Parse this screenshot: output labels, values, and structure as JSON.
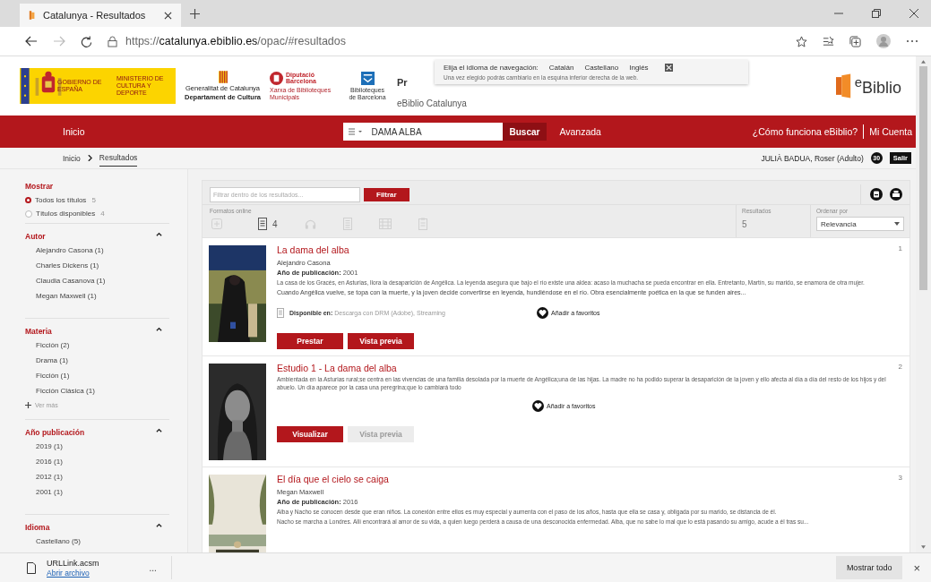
{
  "browser": {
    "tab_title": "Catalunya - Resultados",
    "url": {
      "scheme": "https://",
      "host": "catalunya.ebiblio.es",
      "path": "/opac/#resultados"
    }
  },
  "header": {
    "spain_gov": "GOBIERNO DE ESPAÑA",
    "ministry": "MINISTERIO DE CULTURA Y DEPORTE",
    "generalitat": "Generalitat de Catalunya",
    "department": "Departament de Cultura",
    "diputacio": "Diputació Barcelona",
    "xarxa": "Xarxa de Biblioteques Municipals",
    "bcn": "Biblioteques de Barcelona",
    "platform_start": "Pr",
    "platform": "eBiblio Catalunya",
    "logo": "$^{e}$Biblio"
  },
  "language_popup": {
    "prompt": "Elija el idioma de navegación:",
    "languages": [
      "Catalán",
      "Castellano",
      "Inglés"
    ],
    "note": "Una vez elegido podrás cambiarlo en la esquina inferior derecha de la web."
  },
  "nav": {
    "home": "Inicio",
    "search_value": "DAMA ALBA",
    "search_button": "Buscar",
    "advanced": "Avanzada",
    "help": "¿Cómo funciona eBiblio?",
    "account": "Mi Cuenta"
  },
  "breadcrumb": [
    {
      "label": "Inicio",
      "selected": false
    },
    {
      "label": "Resultados",
      "selected": true
    }
  ],
  "user": {
    "name": "JULIÀ BADUA, Roser (Adulto)",
    "badge": "30",
    "logout": "Salir"
  },
  "sidebar": {
    "show_title": "Mostrar",
    "show_options": [
      {
        "label": "Todos los títulos",
        "count": "5",
        "selected": true
      },
      {
        "label": "Títulos disponibles",
        "count": "4",
        "selected": false
      }
    ],
    "facets": [
      {
        "title": "Autor",
        "expanded": true,
        "items": [
          "Alejandro Casona (1)",
          "Charles Dickens (1)",
          "Claudia Casanova (1)",
          "Megan Maxwell (1)"
        ]
      },
      {
        "title": "Materia",
        "expanded": true,
        "items": [
          "Ficción (2)",
          "Drama (1)",
          "Ficción (1)",
          "Ficción Clásica (1)"
        ],
        "more": "Ver más"
      },
      {
        "title": "Año publicación",
        "expanded": true,
        "items": [
          "2019 (1)",
          "2016 (1)",
          "2012 (1)",
          "2001 (1)"
        ]
      },
      {
        "title": "Idioma",
        "expanded": true,
        "items": [
          "Castellano (5)"
        ]
      }
    ]
  },
  "toolbar": {
    "filter_placeholder": "Filtrar dentro de los resultados...",
    "filter_button": "Filtrar",
    "formats_label": "Formatos online",
    "formats": [
      {
        "kind": "add",
        "enabled": false
      },
      {
        "kind": "ebook",
        "enabled": true,
        "count": "4"
      },
      {
        "kind": "audio",
        "enabled": false
      },
      {
        "kind": "document",
        "enabled": false
      },
      {
        "kind": "video",
        "enabled": false
      },
      {
        "kind": "magazine",
        "enabled": false
      }
    ],
    "results_label": "Resultados",
    "results_count": "5",
    "sort_label": "Ordenar por",
    "sort_value": "Relevancia"
  },
  "results": [
    {
      "number": "1",
      "title": "La dama del alba",
      "author": "Alejandro Casona",
      "year_label": "Año de publicación:",
      "year": "2001",
      "description": [
        "La casa de los Gracés, en Asturias, llora la desaparición de Angélica. La leyenda asegura que bajo el río existe una aldea: acaso la muchacha se pueda encontrar en ella. Entretanto, Martín, su marido, se enamora de otra mujer.",
        "Cuando Angélica vuelve, se topa con la muerte, y la joven decide convertirse en leyenda, hundiéndose en el río. Obra esencialmente poética en la que se funden aires..."
      ],
      "availability_label": "Disponible en:",
      "availability": "Descarga con DRM (Adobe), Streaming",
      "favorite": "Añadir a favoritos",
      "buttons": [
        {
          "label": "Prestar",
          "disabled": false
        },
        {
          "label": "Vista previa",
          "disabled": false
        }
      ]
    },
    {
      "number": "2",
      "title": "Estudio 1 - La dama del alba",
      "description": [
        "Ambientada en la Asturias rural;se centra en las vivencias de una familia desolada por la muerte de Angélica;una de las hijas. La madre no ha podido superar la desaparición de la joven y ello afecta al día a día del resto de los hijos y del abuelo. Un día aparece por la casa una peregrina;que lo cambiará todo"
      ],
      "favorite": "Añadir a favoritos",
      "buttons": [
        {
          "label": "Visualizar",
          "disabled": false
        },
        {
          "label": "Vista previa",
          "disabled": true
        }
      ]
    },
    {
      "number": "3",
      "title": "El día que el cielo se caiga",
      "author": "Megan Maxwell",
      "year_label": "Año de publicación:",
      "year": "2016",
      "description": [
        "Alba y Nacho se conocen desde que eran niños. La conexión entre ellos es muy especial y aumenta con el paso de los años, hasta que ella se casa y, obligada por su marido, se distancia de él.",
        "Nacho se marcha a Londres. Allí encontrará al amor de su vida, a quien luego perderá a causa de una desconocida enfermedad. Alba, que no sabe lo mal que lo está pasando su amigo, acude a él tras su..."
      ]
    }
  ],
  "download_bar": {
    "file": "URLLink.acsm",
    "open": "Abrir archivo",
    "more": "...",
    "show_all": "Mostrar todo",
    "close": "×"
  }
}
